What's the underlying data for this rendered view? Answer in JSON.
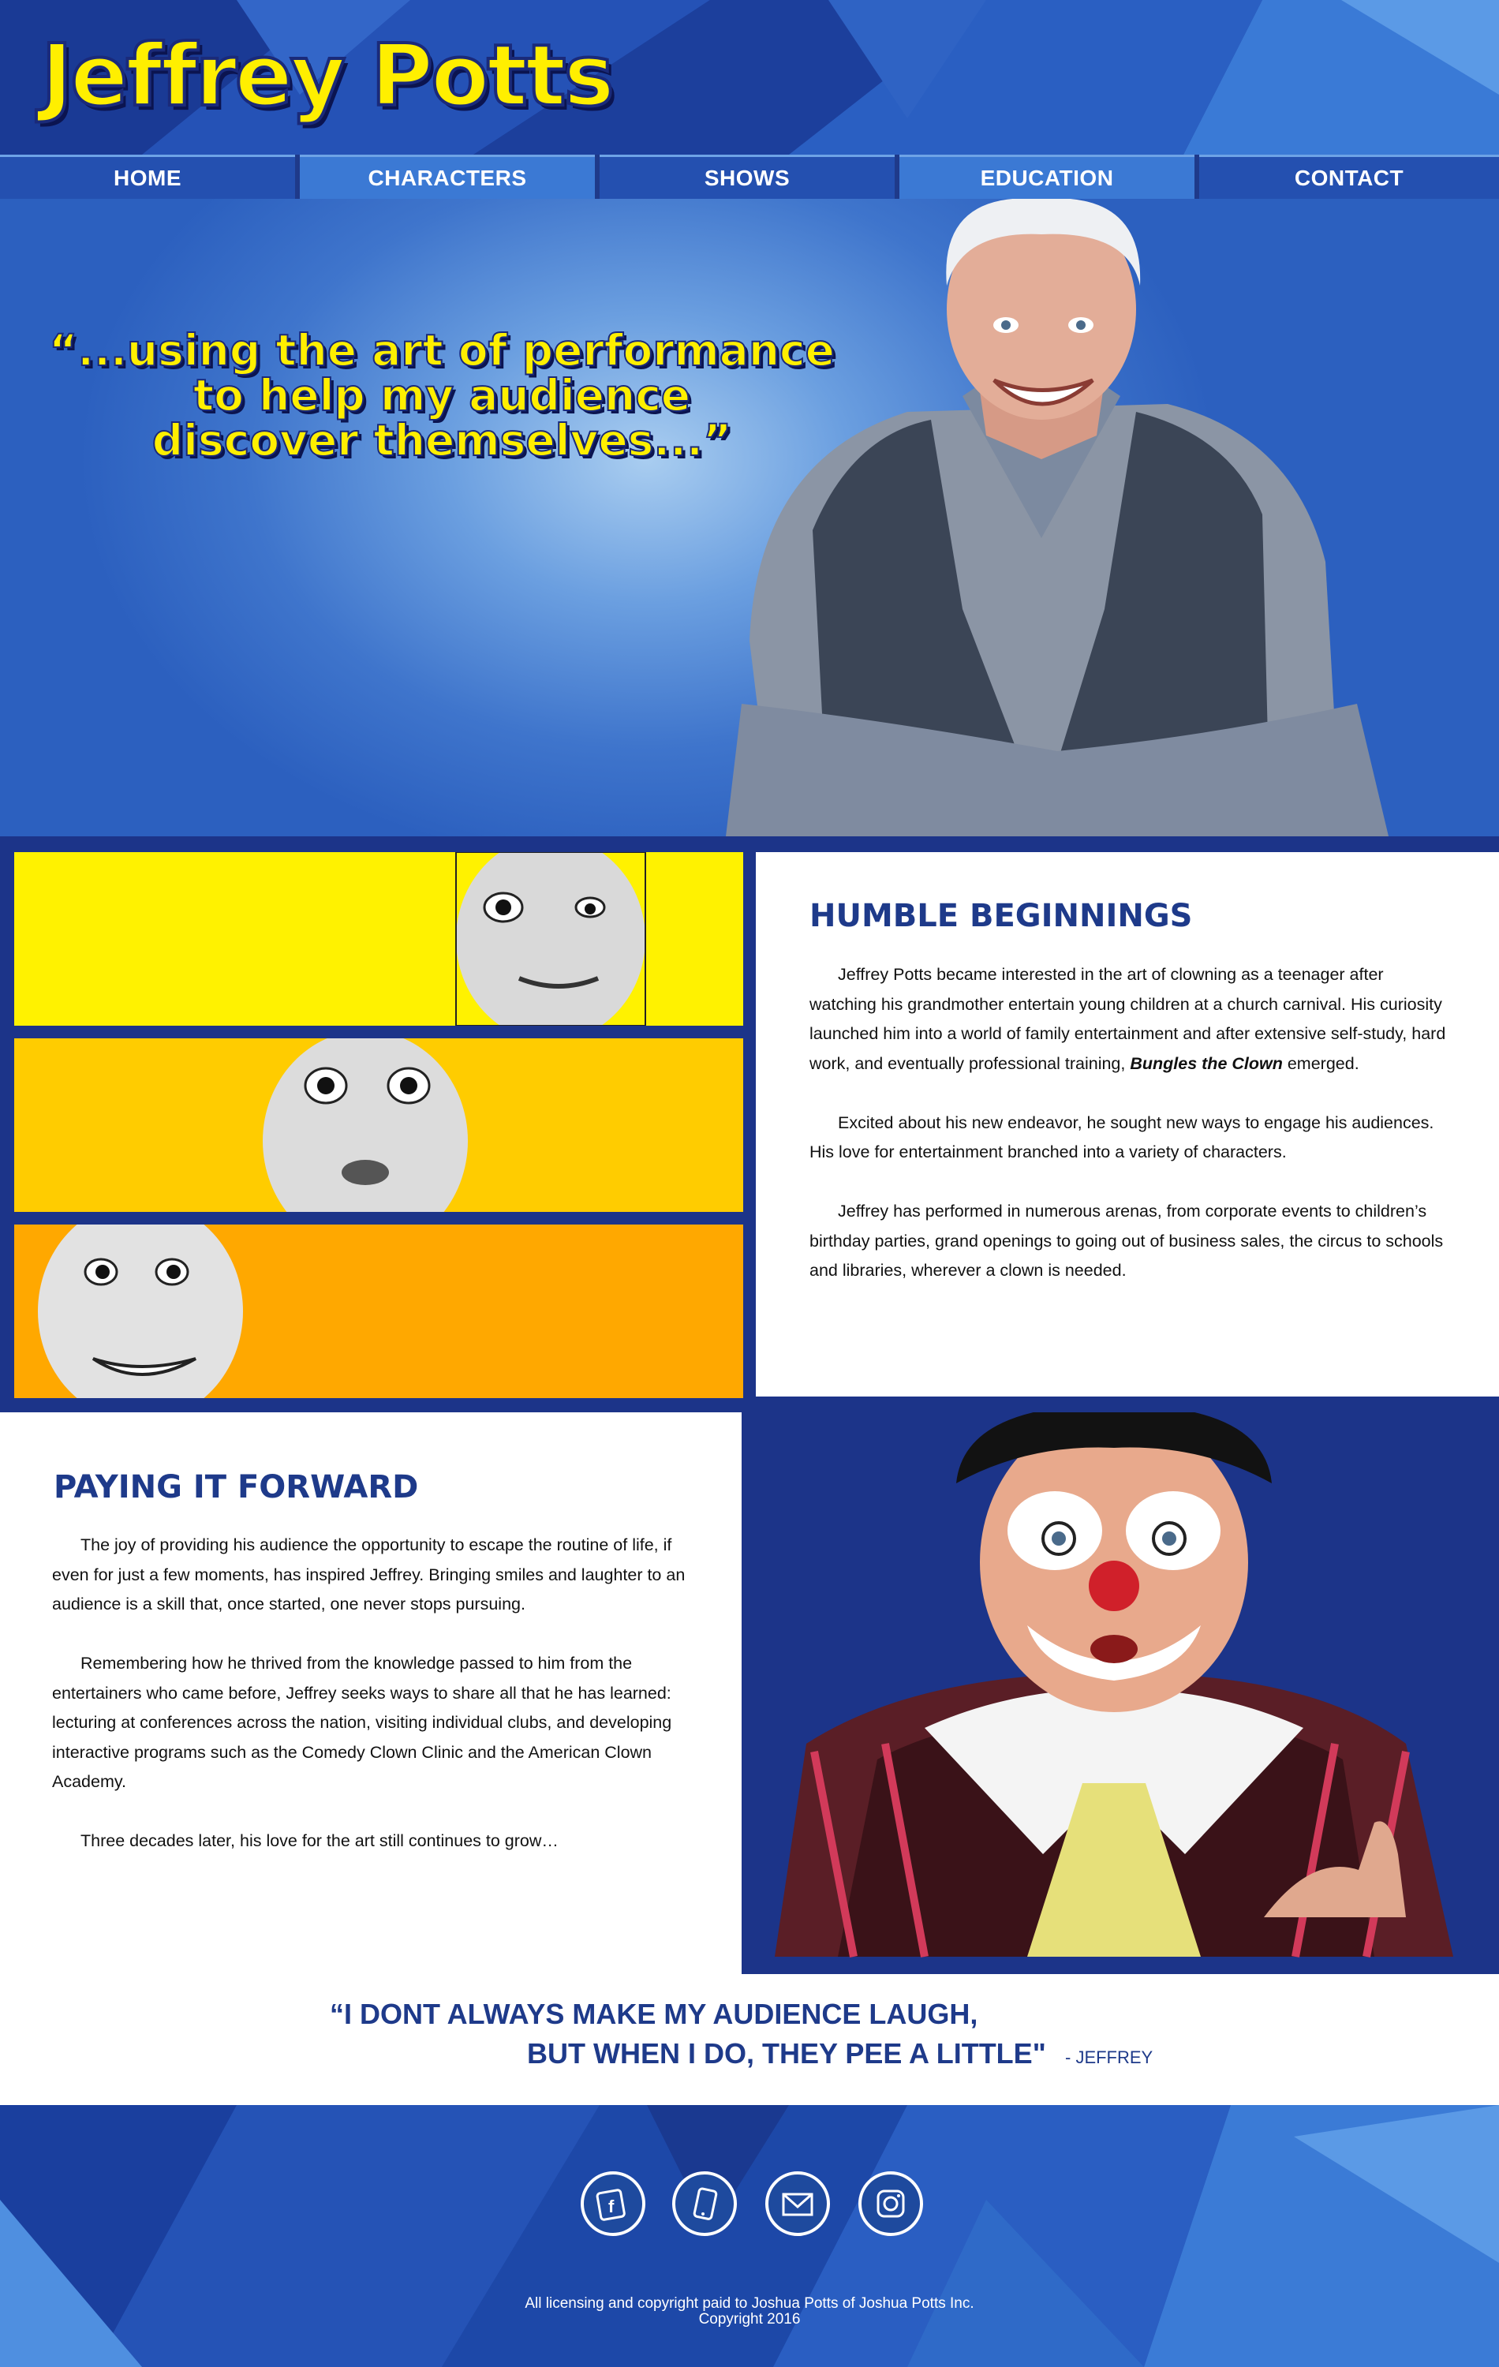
{
  "header": {
    "logo_text": "Jeffrey Potts"
  },
  "nav": {
    "items": [
      {
        "label": "HOME"
      },
      {
        "label": "CHARACTERS"
      },
      {
        "label": "SHOWS"
      },
      {
        "label": "EDUCATION"
      },
      {
        "label": "CONTACT"
      }
    ]
  },
  "hero": {
    "quote_line1": "“...using the art of performance",
    "quote_line2": "to help my audience",
    "quote_line3": "discover themselves...”"
  },
  "humble": {
    "title": "HUMBLE BEGINNINGS",
    "p1_a": "Jeffrey Potts became interested in the art of clowning as a teenager after watching his grandmother entertain young children at a church carnival. His curiosity launched him into a world of family entertainment and after extensive self-study, hard work, and eventually professional training,",
    "p1_em": "Bungles the Clown",
    "p1_b": "emerged.",
    "p2": "Excited about his new endeavor, he sought new ways to engage his audiences.  His love for entertainment branched into a variety of characters.",
    "p3": "Jeffrey has performed in numerous arenas, from corporate events to children’s birthday parties, grand openings to going out of business sales, the circus to schools and libraries, wherever a clown is needed."
  },
  "forward": {
    "title": "PAYING IT FORWARD",
    "p1": "The joy of providing his audience the opportunity to escape the routine of life, if even for just a few moments, has inspired Jeffrey. Bringing smiles and laughter to an audience is a skill that, once started, one never stops pursuing.",
    "p2": "Remembering how he thrived from the knowledge passed to him from the entertainers who came before, Jeffrey seeks ways to share all that he has learned: lecturing at conferences across the nation, visiting individual clubs, and developing interactive programs such as the Comedy Clown Clinic and the American Clown Academy.",
    "p3": "Three decades later, his love for the art still continues to grow…"
  },
  "featured_quote": {
    "line1": "“I DONT ALWAYS MAKE MY AUDIENCE LAUGH,",
    "line2": "BUT WHEN I DO, THEY PEE A LITTLE\"",
    "attribution": "-  JEFFREY"
  },
  "footer": {
    "social": [
      "facebook-icon",
      "phone-icon",
      "mail-icon",
      "instagram-icon"
    ],
    "copyright_line1": "All licensing and copyright paid to Joshua Potts of Joshua Potts Inc.",
    "copyright_line2": "Copyright 2016"
  },
  "colors": {
    "brand_yellow": "#ffef00",
    "brand_navy": "#1e3a8a",
    "nav_dark": "#2450b0",
    "nav_light": "#3b79d4"
  }
}
